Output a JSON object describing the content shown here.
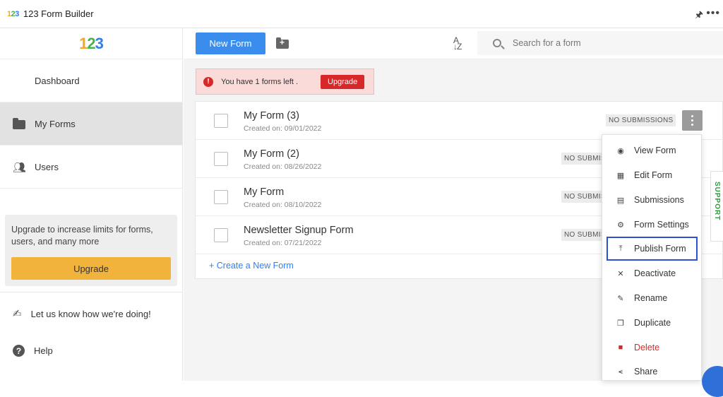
{
  "titlebar": {
    "logo": "123",
    "title": "123 Form Builder",
    "pin_icon": "pin-icon",
    "more_icon": "more-icon"
  },
  "sidebar": {
    "logo": [
      "1",
      "2",
      "3"
    ],
    "items": [
      {
        "label": "Dashboard",
        "icon": "dashboard-icon"
      },
      {
        "label": "My Forms",
        "icon": "folder-icon",
        "active": true
      },
      {
        "label": "Users",
        "icon": "users-icon"
      }
    ],
    "upgrade_text": "Upgrade to increase limits for forms, users, and many more",
    "upgrade_button": "Upgrade",
    "feedback": "Let us know how we're doing!",
    "help": "Help"
  },
  "toolbar": {
    "new_form": "New Form",
    "sort_icon": "A↓Z",
    "search_placeholder": "Search for a form"
  },
  "alert": {
    "message": "You have 1 forms left .",
    "upgrade": "Upgrade"
  },
  "forms": [
    {
      "name": "My Form (3)",
      "created": "Created on: 09/01/2022",
      "status": "NO SUBMISSIONS"
    },
    {
      "name": "My Form (2)",
      "created": "Created on: 08/26/2022",
      "status": "NO SUBMISSIONS"
    },
    {
      "name": "My Form",
      "created": "Created on: 08/10/2022",
      "status": "NO SUBMISSIONS"
    },
    {
      "name": "Newsletter Signup Form",
      "created": "Created on: 07/21/2022",
      "status": "NO SUBMISSIONS"
    }
  ],
  "create_link": "+ Create a New Form",
  "context_menu": [
    {
      "label": "View Form",
      "icon": "eye-icon"
    },
    {
      "label": "Edit Form",
      "icon": "edit-form-icon"
    },
    {
      "label": "Submissions",
      "icon": "submissions-icon"
    },
    {
      "label": "Form Settings",
      "icon": "gear-icon"
    },
    {
      "label": "Publish Form",
      "icon": "publish-icon",
      "highlighted": true
    },
    {
      "label": "Deactivate",
      "icon": "deactivate-icon"
    },
    {
      "label": "Rename",
      "icon": "pencil-icon"
    },
    {
      "label": "Duplicate",
      "icon": "copy-icon"
    },
    {
      "label": "Delete",
      "icon": "trash-icon",
      "danger": true
    },
    {
      "label": "Share",
      "icon": "share-icon"
    }
  ],
  "support_tab": "SUPPORT",
  "colors": {
    "primary": "#3b8ded",
    "upgrade_yellow": "#f2b33d",
    "danger": "#d62828",
    "highlight_border": "#2d4fd6",
    "support_green": "#2e9b3e"
  }
}
